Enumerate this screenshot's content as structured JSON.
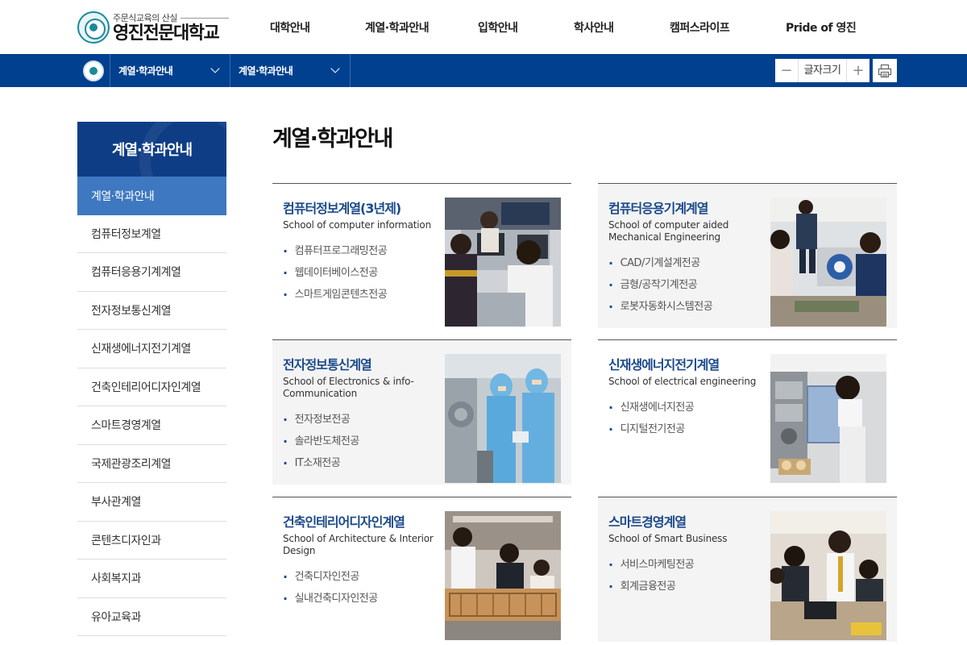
{
  "header": {
    "logo_tagline": "주문식교육의 산실",
    "logo_name": "영진전문대학교",
    "nav": [
      {
        "label": "대학안내"
      },
      {
        "label": "계열·학과안내"
      },
      {
        "label": "입학안내"
      },
      {
        "label": "학사안내"
      },
      {
        "label": "캠퍼스라이프"
      },
      {
        "label": "Pride of 영진"
      }
    ]
  },
  "subbar": {
    "crumb1": "계열·학과안내",
    "crumb2": "계열·학과안내",
    "font_size_label": "글자크기",
    "minus": "−",
    "plus": "+"
  },
  "sidebar": {
    "title": "계열·학과안내",
    "items": [
      {
        "label": "계열·학과안내",
        "active": true
      },
      {
        "label": "컴퓨터정보계열"
      },
      {
        "label": "컴퓨터응용기계계열"
      },
      {
        "label": "전자정보통신계열"
      },
      {
        "label": "신재생에너지전기계열"
      },
      {
        "label": "건축인테리어디자인계열"
      },
      {
        "label": "스마트경영계열"
      },
      {
        "label": "국제관광조리계열"
      },
      {
        "label": "부사관계열"
      },
      {
        "label": "콘텐츠디자인과"
      },
      {
        "label": "사회복지과"
      },
      {
        "label": "유아교육과"
      }
    ]
  },
  "main": {
    "title": "계열·학과안내",
    "cards": [
      {
        "name": "컴퓨터정보계열(3년제)",
        "english": "School of computer information",
        "majors": [
          "컴퓨터프로그래밍전공",
          "웹데이터베이스전공",
          "스마트게임콘텐츠전공"
        ]
      },
      {
        "name": "컴퓨터응용기계계열",
        "english": "School of computer aided Mechanical Engineering",
        "majors": [
          "CAD/기계설계전공",
          "금형/공작기계전공",
          "로봇자동화시스템전공"
        ]
      },
      {
        "name": "전자정보통신계열",
        "english": "School of Electronics & info-Communication",
        "majors": [
          "전자정보전공",
          "솔라반도체전공",
          "IT소재전공"
        ]
      },
      {
        "name": "신재생에너지전기계열",
        "english": "School of electrical engineering",
        "majors": [
          "신재생에너지전공",
          "디지털전기전공"
        ]
      },
      {
        "name": "건축인테리어디자인계열",
        "english": "School of Architecture & Interior Design",
        "majors": [
          "건축디자인전공",
          "실내건축디자인전공"
        ]
      },
      {
        "name": "스마트경영계열",
        "english": "School of Smart Business",
        "majors": [
          "서비스마케팅전공",
          "회계금융전공"
        ]
      }
    ]
  },
  "colors": {
    "brand_blue": "#00408e",
    "sidebar_head": "#0f3d85",
    "sidebar_active": "#3e78c0",
    "card_title": "#1c4a8b"
  }
}
